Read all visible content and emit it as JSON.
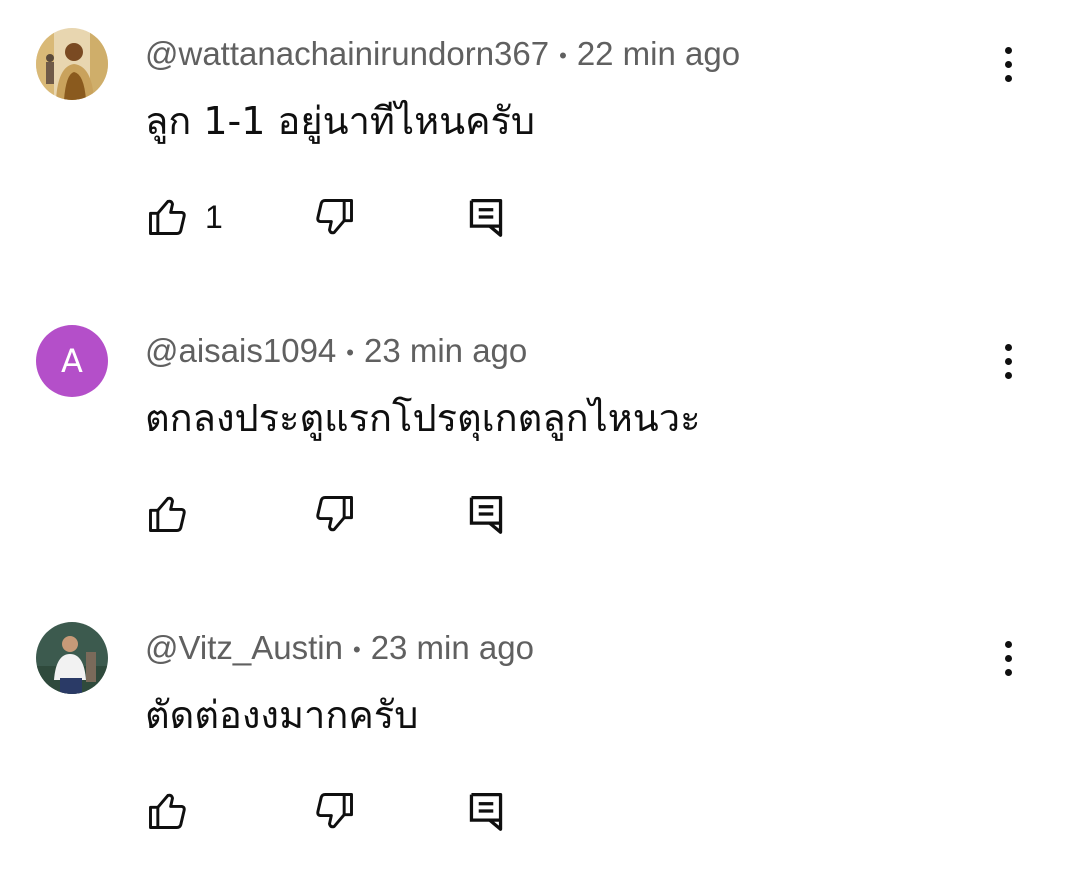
{
  "comments": [
    {
      "handle": "@wattanachainirundorn367",
      "separator": "•",
      "time": "22 min ago",
      "text": "ลูก 1-1 อยู่นาทีไหนครับ",
      "likes": "1",
      "avatar": {
        "type": "photo",
        "colors": [
          "#c9a25c",
          "#8a5a1e",
          "#e8d6b0"
        ]
      }
    },
    {
      "handle": "@aisais1094",
      "separator": "•",
      "time": "23 min ago",
      "text": "ตกลงประตูแรกโปรตุเกตลูกไหนวะ",
      "likes": "",
      "avatar": {
        "type": "letter",
        "letter": "A",
        "color": "#b44fc9"
      }
    },
    {
      "handle": "@Vitz_Austin",
      "separator": "•",
      "time": "23 min ago",
      "text": "ตัดต่องงมากครับ",
      "likes": "",
      "avatar": {
        "type": "photo",
        "colors": [
          "#3c5a4e",
          "#f2f2f2",
          "#2a3a66"
        ]
      }
    }
  ],
  "icons": {
    "like": "thumbs-up-icon",
    "dislike": "thumbs-down-icon",
    "reply": "reply-icon",
    "more": "more-vertical-icon"
  },
  "colors": {
    "text_primary": "#0f0f0f",
    "text_secondary": "#606060",
    "background": "#ffffff"
  }
}
